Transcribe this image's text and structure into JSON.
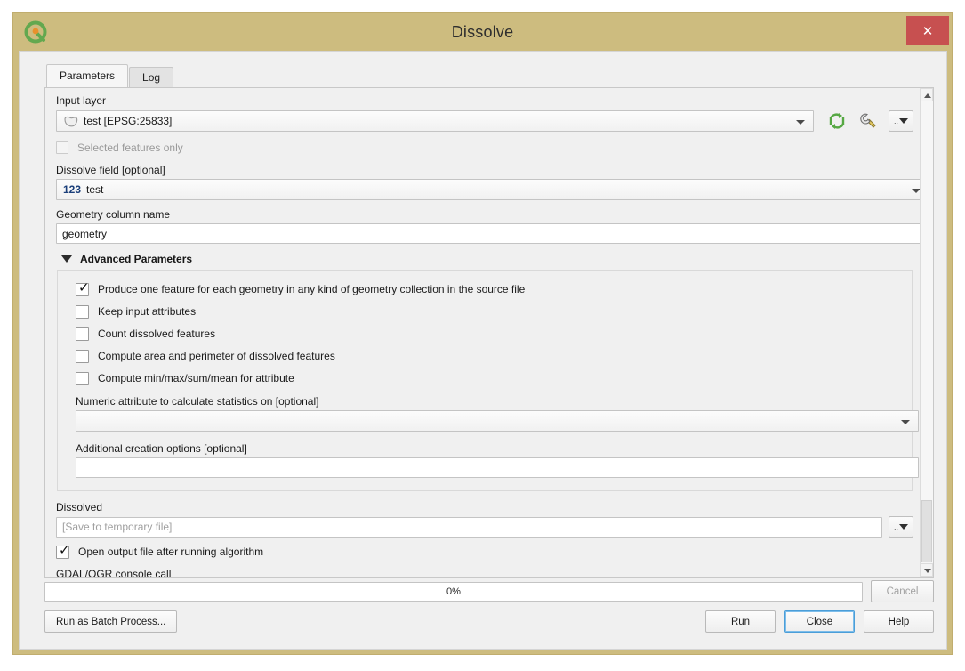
{
  "window": {
    "title": "Dissolve",
    "logo_icon": "qgis-logo-icon",
    "close_label": "✕"
  },
  "tabs": [
    {
      "label": "Parameters",
      "active": true
    },
    {
      "label": "Log",
      "active": false
    }
  ],
  "parameters": {
    "input_layer": {
      "label": "Input layer",
      "value": "test [EPSG:25833]",
      "layer_icon": "polygon-layer-icon",
      "iterate_icon": "iterate-over-features-icon",
      "advanced_icon": "wrench-tool-icon",
      "data_define_icon": "data-defined-override-icon"
    },
    "selected_features_only": {
      "label": "Selected features only",
      "checked": false,
      "enabled": false
    },
    "dissolve_field": {
      "label": "Dissolve field [optional]",
      "type_badge": "123",
      "value": "test"
    },
    "geometry_column_name": {
      "label": "Geometry column name",
      "value": "geometry"
    },
    "advanced": {
      "title": "Advanced Parameters",
      "expanded": true,
      "checkboxes": [
        {
          "label": "Produce one feature for each geometry in any kind of geometry collection in the source file",
          "checked": true
        },
        {
          "label": "Keep input attributes",
          "checked": false
        },
        {
          "label": "Count dissolved features",
          "checked": false
        },
        {
          "label": "Compute area and perimeter of dissolved features",
          "checked": false
        },
        {
          "label": "Compute min/max/sum/mean for attribute",
          "checked": false
        }
      ],
      "numeric_attribute": {
        "label": "Numeric attribute to calculate statistics on [optional]",
        "value": ""
      },
      "creation_options": {
        "label": "Additional creation options [optional]",
        "value": ""
      }
    },
    "output": {
      "label": "Dissolved",
      "placeholder": "[Save to temporary file]",
      "value": "",
      "browse_icon": "save-file-dropdown-icon"
    },
    "open_output": {
      "label": "Open output file after running algorithm",
      "checked": true
    },
    "console_call": {
      "label": "GDAL/OGR console call"
    }
  },
  "footer": {
    "progress_text": "0%",
    "progress_percent": 0,
    "cancel_label": "Cancel",
    "cancel_enabled": false,
    "batch_label": "Run as Batch Process...",
    "run_label": "Run",
    "close_label": "Close",
    "help_label": "Help"
  },
  "colors": {
    "titlebar": "#cdbc7f",
    "close_button": "#c75050",
    "client_bg": "#f0f0f0",
    "accent_focus": "#4b9ed8",
    "badge_blue": "#1b3f7a",
    "iterate_green": "#56a843"
  }
}
